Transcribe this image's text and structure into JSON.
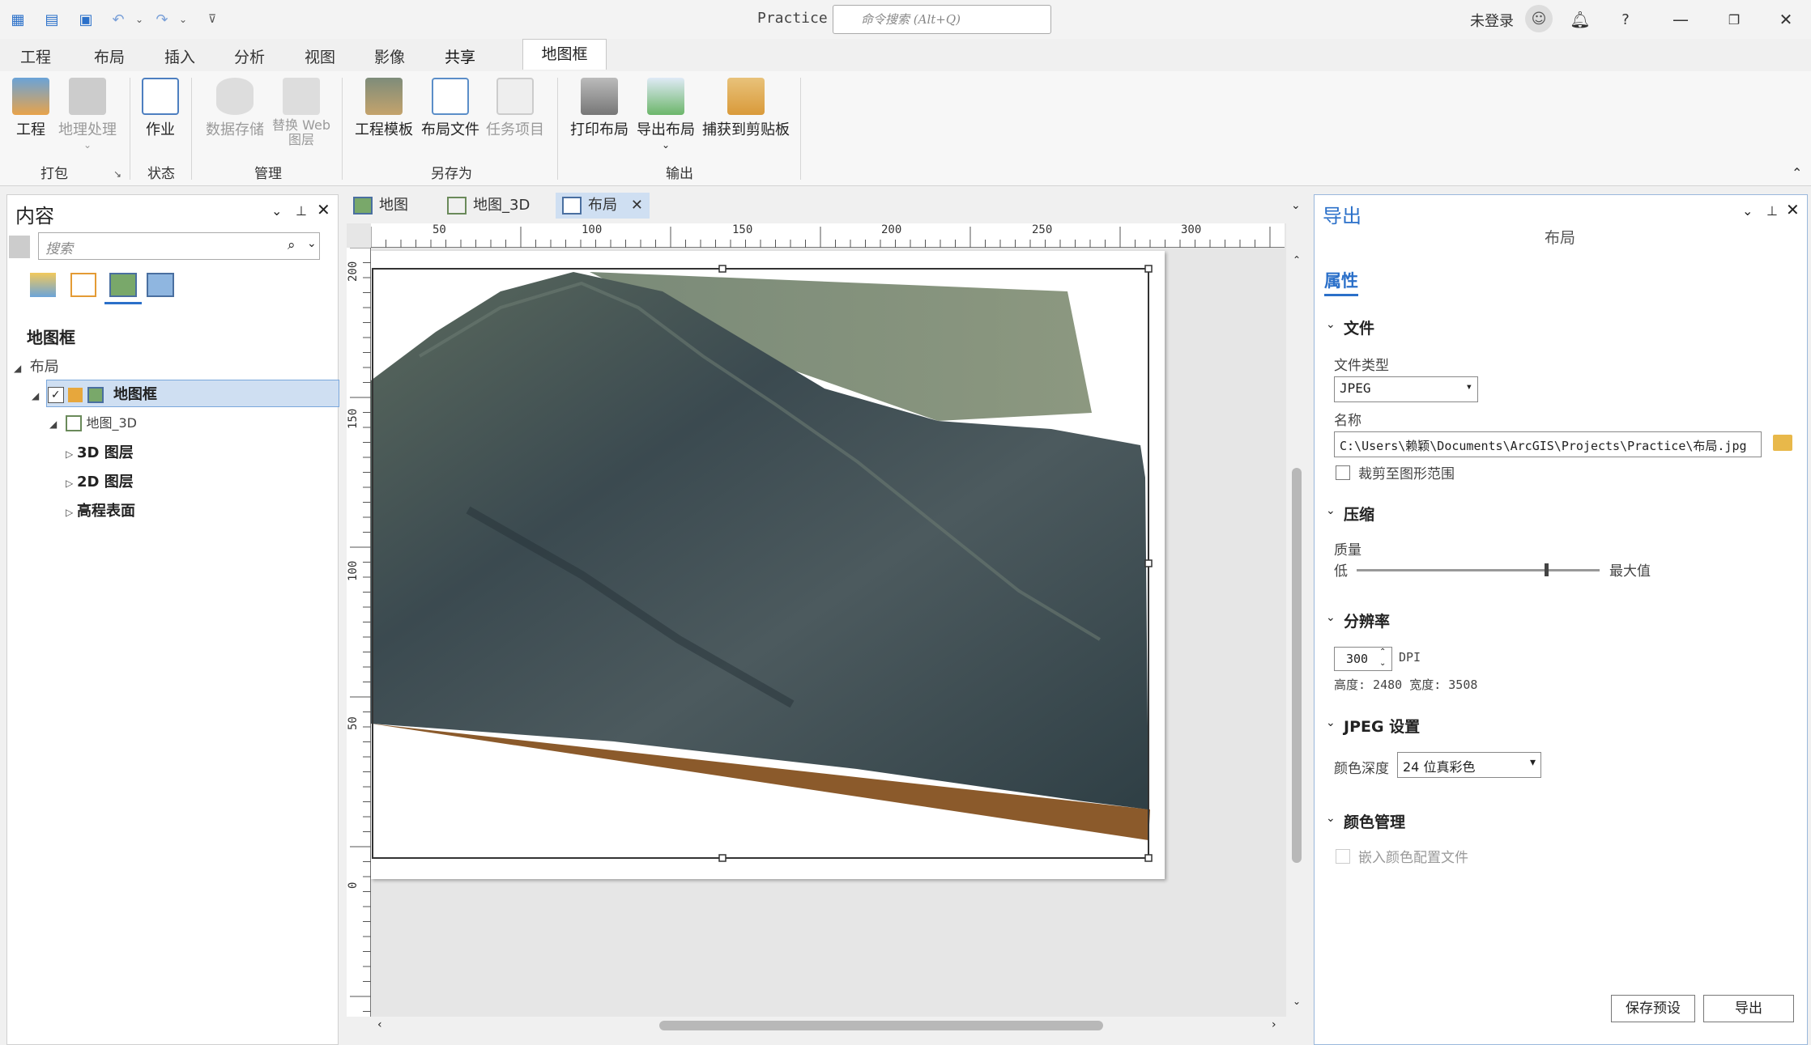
{
  "titlebar": {
    "app_title": "Practice",
    "search_placeholder": "命令搜索 (Alt+Q)",
    "login_label": "未登录",
    "help": "?"
  },
  "ribbon_tabs": [
    "工程",
    "布局",
    "插入",
    "分析",
    "视图",
    "影像",
    "共享"
  ],
  "ribbon_active_tab": "共享",
  "contextual_tab": "地图框",
  "ribbon": {
    "buttons": {
      "project": "工程",
      "geoprocessing": "地理处理",
      "job": "作业",
      "data_store": "数据存储",
      "replace_web_layer": "替换 Web 图层",
      "project_template": "工程模板",
      "layout_file": "布局文件",
      "task_item": "任务项目",
      "print_layout": "打印布局",
      "export_layout": "导出布局",
      "capture_clipboard": "捕获到剪贴板"
    },
    "groups": {
      "package": "打包",
      "status": "状态",
      "manage": "管理",
      "save_as": "另存为",
      "output": "输出"
    }
  },
  "contents": {
    "title": "内容",
    "search_placeholder": "搜索",
    "heading": "地图框",
    "tree": {
      "layout": "布局",
      "mapframe": "地图框",
      "map3d": "地图_3D",
      "layers3d": "3D 图层",
      "layers2d": "2D 图层",
      "elevation": "高程表面"
    }
  },
  "view_tabs": {
    "map": "地图",
    "map3d": "地图_3D",
    "layout": "布局"
  },
  "ruler": {
    "h_ticks": [
      "50",
      "100",
      "150",
      "200",
      "250",
      "300"
    ],
    "v_ticks": [
      "200",
      "150",
      "100",
      "50",
      "0"
    ]
  },
  "export": {
    "title": "导出",
    "subtitle": "布局",
    "properties_tab": "属性",
    "file_section": "文件",
    "file_type_label": "文件类型",
    "file_type_value": "JPEG",
    "name_label": "名称",
    "name_value": "C:\\Users\\赖颖\\Documents\\ArcGIS\\Projects\\Practice\\布局.jpg",
    "clip_label": "裁剪至图形范围",
    "compression_section": "压缩",
    "quality_label": "质量",
    "quality_low": "低",
    "quality_high": "最大值",
    "quality_value": 0.78,
    "resolution_section": "分辨率",
    "dpi_value": "300",
    "dpi_unit": "DPI",
    "dims": "高度: 2480 宽度: 3508",
    "jpeg_section": "JPEG 设置",
    "color_depth_label": "颜色深度",
    "color_depth_value": "24 位真彩色",
    "color_mgmt_section": "颜色管理",
    "embed_profile_label": "嵌入颜色配置文件",
    "save_preset": "保存预设",
    "export_button": "导出"
  },
  "colors": {
    "accent": "#2b70c9",
    "selection": "#cfdff2",
    "terrain_base": "#8b5a2b"
  }
}
